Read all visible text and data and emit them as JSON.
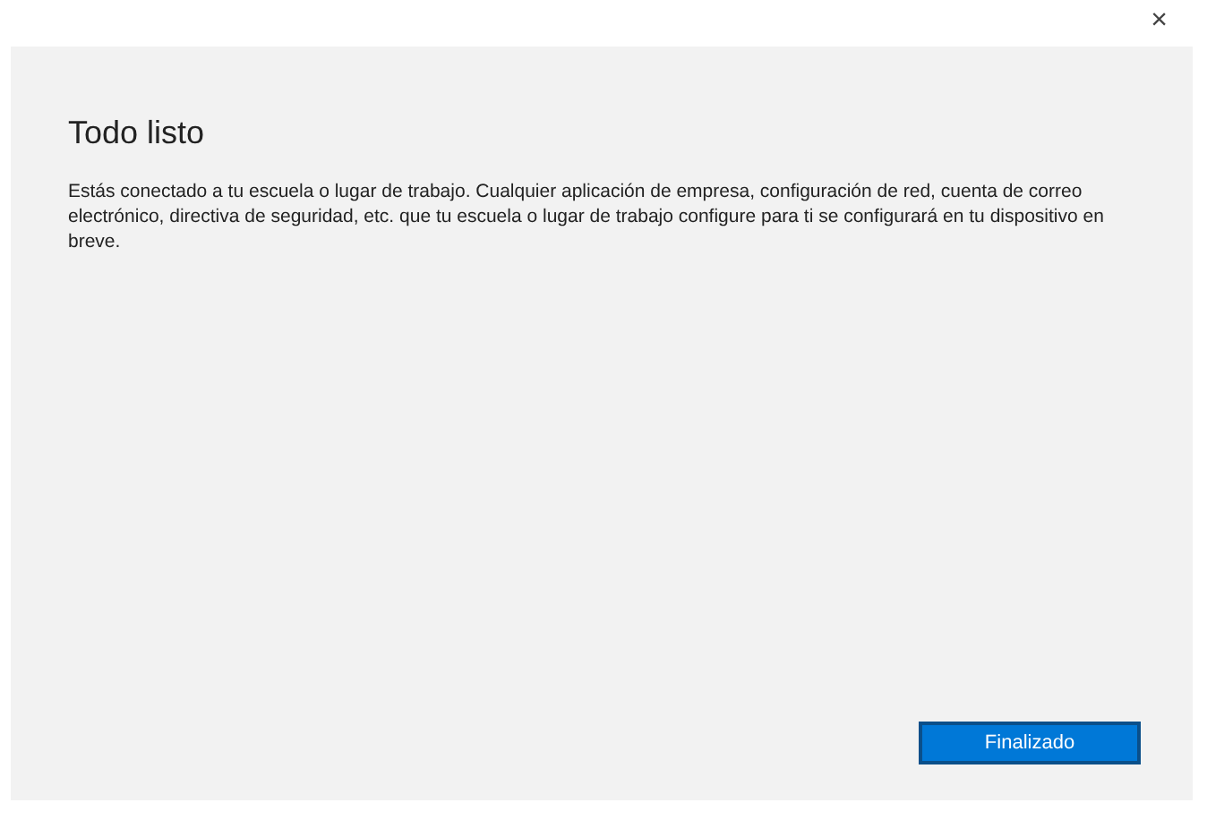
{
  "close_button": "×",
  "title": "Todo listo",
  "message": "Estás conectado a tu escuela o lugar de trabajo. Cualquier aplicación de empresa, configuración de red, cuenta de correo electrónico, directiva de seguridad, etc. que tu escuela o lugar de trabajo configure para ti se configurará en tu dispositivo en breve.",
  "buttons": [
    {
      "label": "Finalizado",
      "kind": "primary"
    }
  ]
}
